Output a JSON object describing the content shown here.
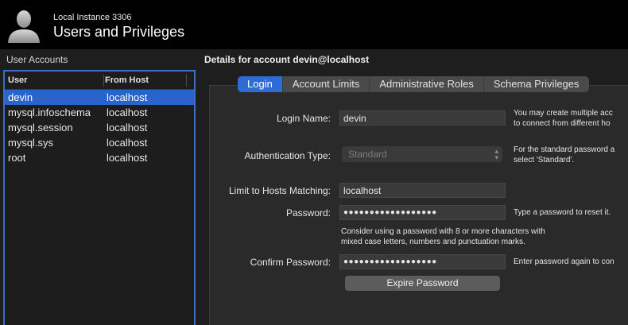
{
  "header": {
    "instance": "Local Instance 3306",
    "title": "Users and Privileges",
    "avatar_icon": "user-silhouette-icon"
  },
  "sidebar": {
    "label": "User Accounts",
    "columns": [
      "User",
      "From Host"
    ],
    "rows": [
      {
        "user": "devin",
        "host": "localhost",
        "selected": true
      },
      {
        "user": "mysql.infoschema",
        "host": "localhost"
      },
      {
        "user": "mysql.session",
        "host": "localhost"
      },
      {
        "user": "mysql.sys",
        "host": "localhost"
      },
      {
        "user": "root",
        "host": "localhost"
      }
    ]
  },
  "details": {
    "title": "Details for account devin@localhost",
    "tabs": [
      "Login",
      "Account Limits",
      "Administrative Roles",
      "Schema Privileges"
    ],
    "active_tab": "Login",
    "login_name_label": "Login Name:",
    "login_name_value": "devin",
    "login_name_hint1": "You may create multiple acc",
    "login_name_hint2": "to connect from different ho",
    "auth_type_label": "Authentication Type:",
    "auth_type_value": "Standard",
    "auth_type_hint1": "For the standard password a",
    "auth_type_hint2": "select 'Standard'.",
    "hosts_label": "Limit to Hosts Matching:",
    "hosts_value": "localhost",
    "password_label": "Password:",
    "password_value": "●●●●●●●●●●●●●●●●●●",
    "password_hint": "Type a password to reset it.",
    "password_note1": "Consider using a password with 8 or more characters with",
    "password_note2": "mixed case letters, numbers and punctuation marks.",
    "confirm_label": "Confirm Password:",
    "confirm_value": "●●●●●●●●●●●●●●●●●●",
    "confirm_hint": "Enter password again to con",
    "expire_button": "Expire Password"
  },
  "colors": {
    "accent": "#2a63c9",
    "header_bg": "#000000",
    "window_bg": "#1e1e1e"
  }
}
